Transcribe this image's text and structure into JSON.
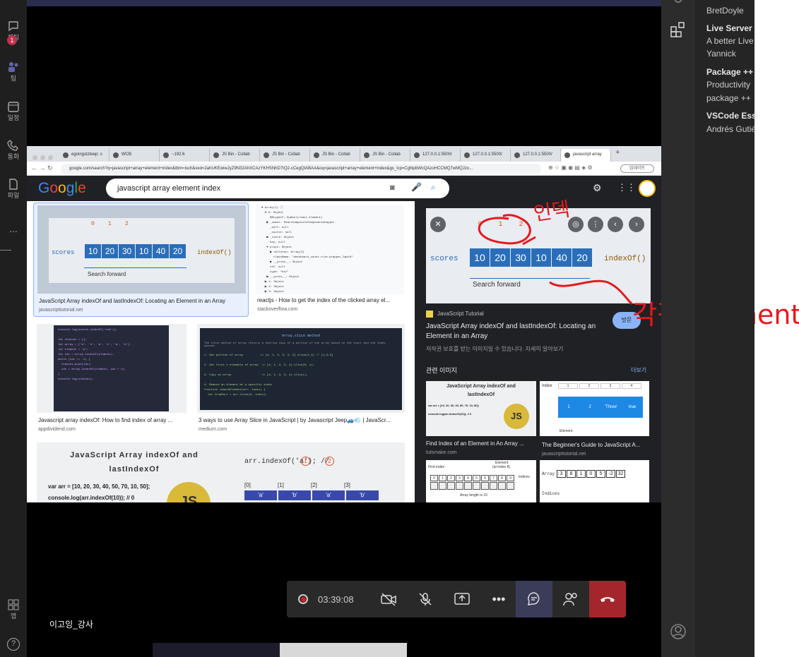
{
  "teams_rail": {
    "items": [
      {
        "label": "채팅",
        "badge": "1"
      },
      {
        "label": "팀"
      },
      {
        "label": "일정"
      },
      {
        "label": "통화"
      },
      {
        "label": "파일"
      },
      {
        "label": "..."
      }
    ],
    "apps_label": "앱",
    "help_label": "?"
  },
  "browser": {
    "tabs": [
      {
        "label": "egoingstzteep: x"
      },
      {
        "label": "WCB"
      },
      {
        "label": "~192:6"
      },
      {
        "label": "JS Bin - Collab"
      },
      {
        "label": "JS Bin - Collab"
      },
      {
        "label": "JS Bin - Collab"
      },
      {
        "label": "JS Bin - Collab"
      },
      {
        "label": "127.0.0.1:5500/"
      },
      {
        "label": "127.0.0.1:5500/"
      },
      {
        "label": "127.0.0.1:5500/"
      },
      {
        "label": "javascript array"
      }
    ],
    "new_tab": "+",
    "url": "google.com/search?q=javascript+array+element+index&tbm=isch&ved=2ahUKEwiwJyZ9N32AhXCAzYKHSNhD7IQ2-cCegQIABAA&oq=javascript+array+element+index&gs_lcp=CgNpbWcQAzoHCCMQ7wMQJzo...",
    "guest_label": "업데이트"
  },
  "google": {
    "logo": "Google",
    "query": "javascript array element index"
  },
  "results": [
    {
      "caption": "JavaScript Array indexOf and lastIndexOf: Locating an Element in an Array",
      "source": "javascripttutorial.net"
    },
    {
      "caption": "reactjs - How to get the index of the clicked array el...",
      "source": "stackoverflow.com"
    },
    {
      "caption": "Javascript array indexOf: How to find index of array ...",
      "source": "appdividend.com"
    },
    {
      "caption": "3 ways to use Array Slice in JavaScript | by Javascript Jeep🚙💨 | JavaScr...",
      "source": "medium.com"
    }
  ],
  "thumb_scores": {
    "indices": [
      "0",
      "1",
      "2"
    ],
    "label": "scores",
    "values": [
      "10",
      "20",
      "30",
      "10",
      "40",
      "20"
    ],
    "method": "indexOf()",
    "search": "Search forward"
  },
  "thumb_js": {
    "title1": "JavaScript Array indexOf and",
    "title2": "lastIndexOf",
    "line1": "var arr = [10, 20, 30, 40, 50, 70, 10, 50];",
    "line2": "console.log(arr.indexOf(10)); // 0",
    "badge": "JS"
  },
  "thumb_slice": {
    "code": "arr.indexOf('a'); //",
    "n1": "1",
    "n2": "2",
    "idx": [
      "[0]",
      "[1]",
      "[2]",
      "[3]"
    ],
    "cells": [
      "'a'",
      "'b'",
      "'a'",
      "'b'"
    ]
  },
  "thumb_medium": {
    "title": "Array.slice method",
    "desc": "The slice method of array returns a shallow copy of a portion of the array based on the start and end index passed."
  },
  "panel": {
    "site": "JavaScript Tutorial",
    "title": "JavaScript Array indexOf and lastIndexOf: Locating an Element in an Array",
    "notice": "저작권 보호를 받는 이미지일 수 있습니다.  자세히 알아보기",
    "visit": "방문",
    "related_label": "관련 이미지",
    "more": "더보기",
    "related": [
      {
        "caption": "Find Index of an Element in An Array ...",
        "source": "tutsmake.com"
      },
      {
        "caption": "The Beginner's Guide to JavaScript A...",
        "source": "javascripttutorial.net"
      }
    ],
    "r2": {
      "index": "Index",
      "cols": [
        "1",
        "2",
        "3",
        "4"
      ],
      "vals": [
        "1",
        "2",
        "'Three'",
        "true"
      ],
      "element": "Element"
    },
    "r3": {
      "first": "First index",
      "el": "Element",
      "el2": "(at index 8)",
      "indices": "Indices",
      "len": "Array length is 10"
    },
    "r4": {
      "label": "Array :",
      "vals": [
        "3",
        "8",
        "1",
        "0",
        "5",
        "-2",
        "32"
      ],
      "indices": "Indices"
    }
  },
  "annotations": {
    "index_note": "인덱",
    "element_note": "각각 Element"
  },
  "meeting": {
    "timer": "03:39:08",
    "presenter": "이고잉_강사"
  },
  "vscode": {
    "extensions": [
      {
        "name": "BretDoyle"
      },
      {
        "name": "Live Server",
        "desc": "A better Live",
        "author": "Yannick"
      },
      {
        "name": "Package ++",
        "desc": "Productivity",
        "author": "package ++"
      },
      {
        "name": "VSCode Ess",
        "author": "Andrés Gutié"
      }
    ]
  },
  "colors": {
    "accent": "#1a73e8",
    "end_call": "#c4314b",
    "annotation": "#e5191e"
  }
}
